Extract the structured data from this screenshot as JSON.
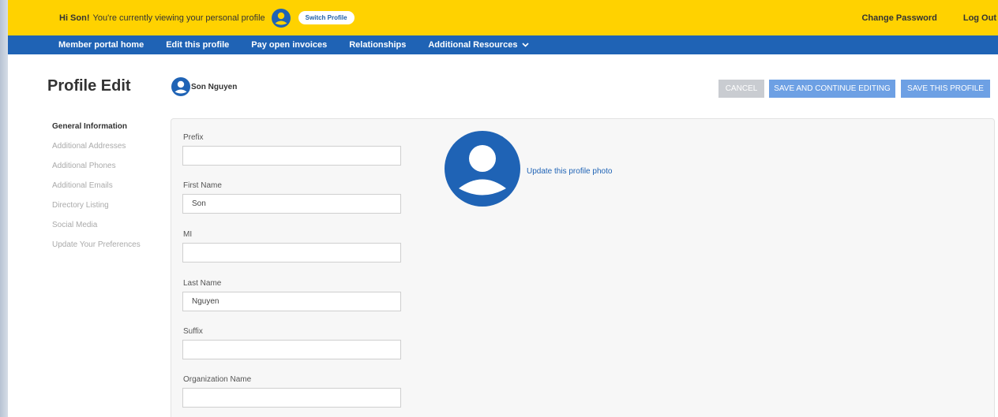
{
  "colors": {
    "topbar_bg": "#ffd200",
    "nav_bg": "#1f63b5",
    "primary_button": "#6da0e4",
    "disabled_button": "#c9ccd1",
    "avatar": "#1f63b5"
  },
  "topbar": {
    "greeting": "Hi Son!",
    "message": "You're currently viewing your personal profile",
    "user_icon": "user-circle-icon",
    "switch_profile": "Switch Profile",
    "change_password": "Change Password",
    "logout": "Log Out"
  },
  "nav": {
    "items": [
      {
        "label": "Member portal home"
      },
      {
        "label": "Edit this profile"
      },
      {
        "label": "Pay open invoices"
      },
      {
        "label": "Relationships"
      },
      {
        "label": "Additional Resources",
        "icon": "chevron-down-icon"
      }
    ]
  },
  "header": {
    "title": "Profile Edit",
    "profile_name": "Son Nguyen",
    "cancel": "CANCEL",
    "save_continue": "SAVE AND CONTINUE EDITING",
    "save": "SAVE THIS PROFILE"
  },
  "sidebar": {
    "items": [
      {
        "label": "General Information",
        "active": true
      },
      {
        "label": "Additional Addresses"
      },
      {
        "label": "Additional Phones"
      },
      {
        "label": "Additional Emails"
      },
      {
        "label": "Directory Listing"
      },
      {
        "label": "Social Media"
      },
      {
        "label": "Update Your Preferences"
      }
    ]
  },
  "form": {
    "fields": [
      {
        "label": "Prefix",
        "value": ""
      },
      {
        "label": "First Name",
        "value": "Son"
      },
      {
        "label": "MI",
        "value": ""
      },
      {
        "label": "Last Name",
        "value": "Nguyen"
      },
      {
        "label": "Suffix",
        "value": ""
      },
      {
        "label": "Organization Name",
        "value": ""
      }
    ],
    "photo_icon": "user-avatar-icon",
    "photo_link": "Update this profile photo"
  }
}
